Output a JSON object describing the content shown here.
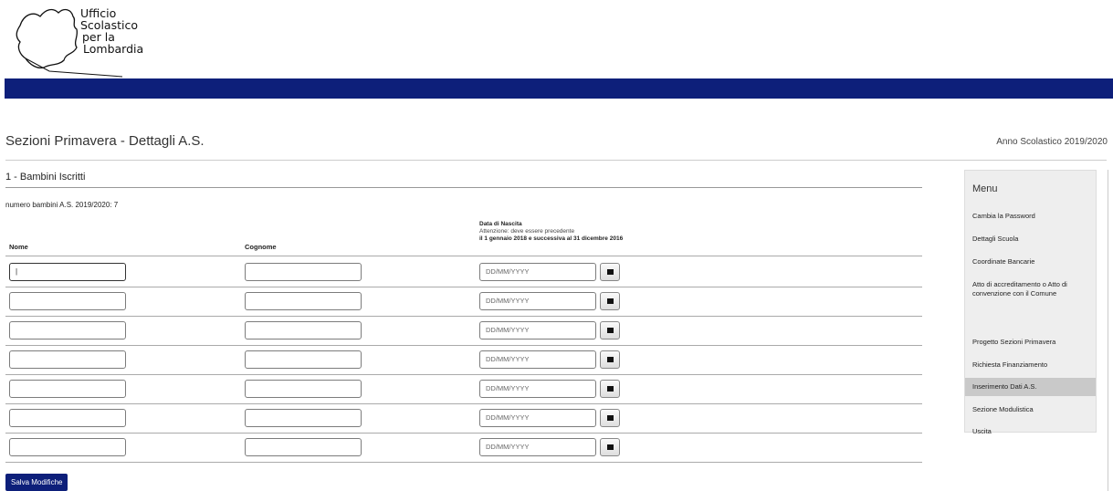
{
  "header": {
    "logo_lines": [
      "Ufficio",
      "Scolastico",
      "per la",
      "Lombardia"
    ]
  },
  "page": {
    "title": "Sezioni Primavera - Dettagli A.S.",
    "school_year": "Anno Scolastico 2019/2020"
  },
  "section": {
    "title": "1 - Bambini Iscritti",
    "count_line": "numero bambini A.S. 2019/2020: 7"
  },
  "table": {
    "col_nome": "Nome",
    "col_cognome": "Cognome",
    "col_date_title": "Data di Nascita",
    "col_date_warning": "Attenzione: deve essere precedente",
    "col_date_range": "il 1 gennaio 2018 e successiva al 31 dicembre 2016",
    "rows": [
      {
        "nome": "|",
        "cognome": "",
        "date_placeholder": "DD/MM/YYYY"
      },
      {
        "nome": "",
        "cognome": "",
        "date_placeholder": "DD/MM/YYYY"
      },
      {
        "nome": "",
        "cognome": "",
        "date_placeholder": "DD/MM/YYYY"
      },
      {
        "nome": "",
        "cognome": "",
        "date_placeholder": "DD/MM/YYYY"
      },
      {
        "nome": "",
        "cognome": "",
        "date_placeholder": "DD/MM/YYYY"
      },
      {
        "nome": "",
        "cognome": "",
        "date_placeholder": "DD/MM/YYYY"
      },
      {
        "nome": "",
        "cognome": "",
        "date_placeholder": "DD/MM/YYYY"
      }
    ]
  },
  "actions": {
    "save_label": "Salva Modifiche"
  },
  "menu": {
    "title": "Menu",
    "items": [
      {
        "label": "Cambia la Password"
      },
      {
        "label": "Dettagli Scuola"
      },
      {
        "label": "Coordinate Bancarie"
      },
      {
        "label": "Atto di accreditamento o Atto di convenzione con il Comune"
      },
      {
        "label": "Progetto Sezioni Primavera"
      },
      {
        "label": "Richiesta Finanziamento"
      },
      {
        "label": "Inserimento Dati A.S."
      },
      {
        "label": "Sezione Modulistica"
      },
      {
        "label": "Uscita"
      }
    ],
    "active_index": 6
  },
  "colors": {
    "brand_blue": "#0d1f7a",
    "menu_bg": "#eeeeee",
    "menu_active": "#c9c9c9"
  }
}
